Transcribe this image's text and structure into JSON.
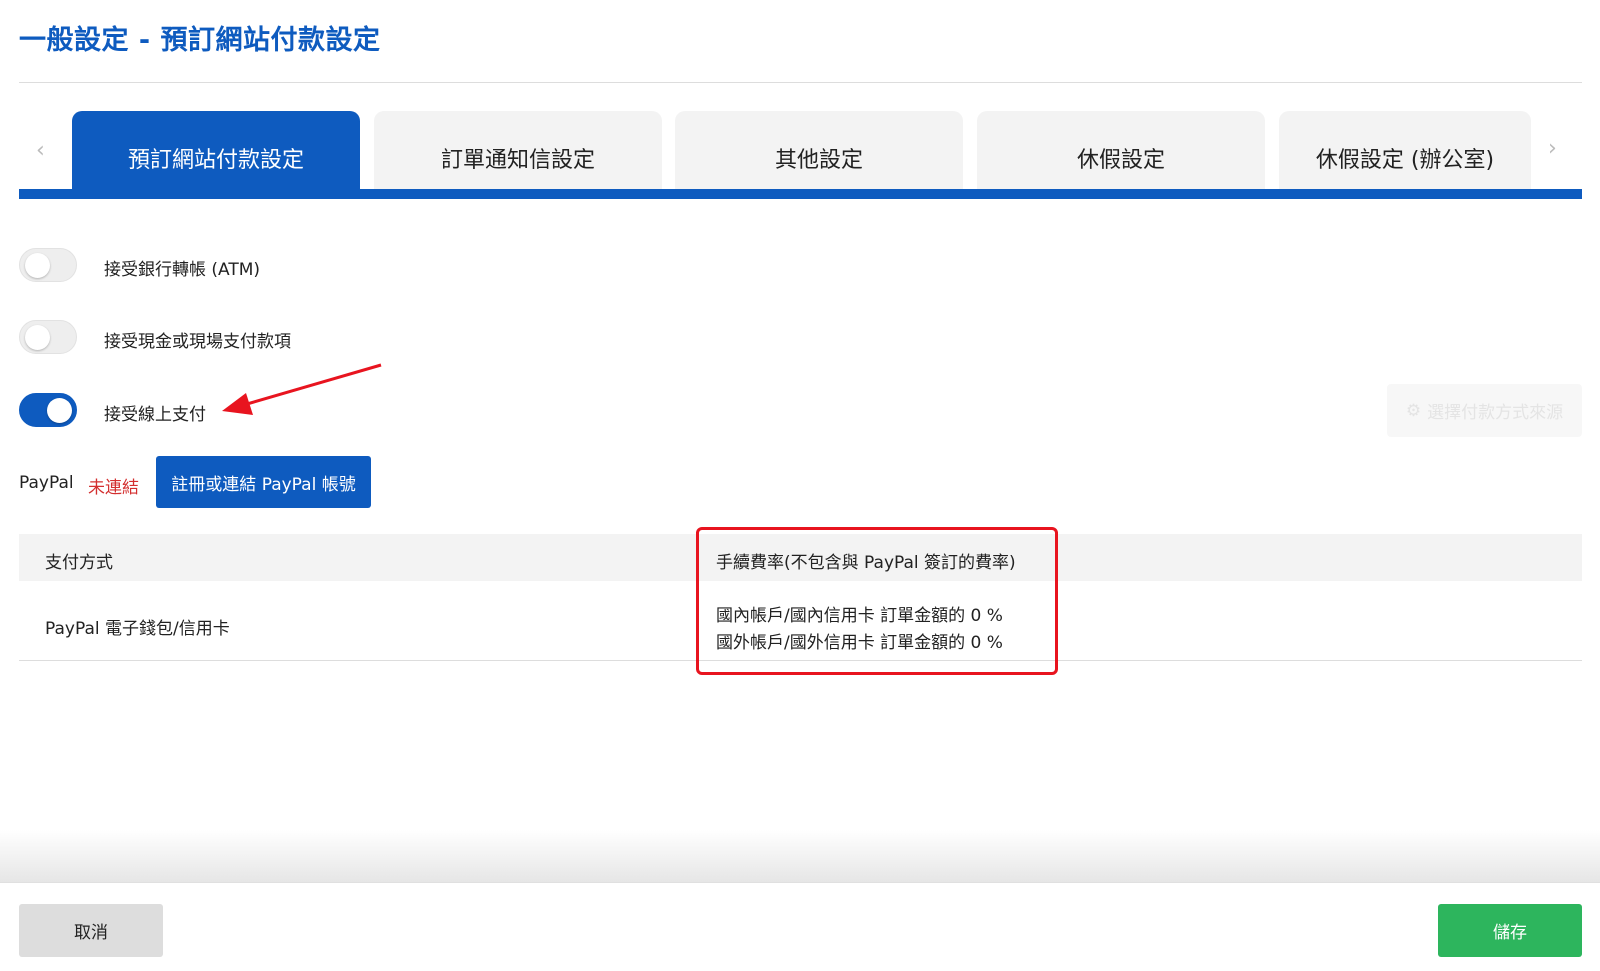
{
  "header": {
    "title": "一般設定 - 預訂網站付款設定"
  },
  "tabs": [
    {
      "label": "預訂網站付款設定",
      "active": true
    },
    {
      "label": "訂單通知信設定",
      "active": false
    },
    {
      "label": "其他設定",
      "active": false
    },
    {
      "label": "休假設定",
      "active": false
    },
    {
      "label": "休假設定 (辦公室)",
      "active": false
    }
  ],
  "tab_nav": {
    "prev_icon": "chevron-left-icon",
    "next_icon": "chevron-right-icon"
  },
  "toggles": [
    {
      "label": "接受銀行轉帳 (ATM)",
      "on": false
    },
    {
      "label": "接受現金或現場支付款項",
      "on": false
    },
    {
      "label": "接受線上支付",
      "on": true
    }
  ],
  "source_button": {
    "label": "選擇付款方式來源",
    "icon": "gear-icon"
  },
  "paypal": {
    "label": "PayPal",
    "status": "未連結",
    "status_color": "#d32f2f",
    "connect_button": "註冊或連結 PayPal 帳號"
  },
  "table": {
    "headers": [
      "支付方式",
      "手續費率(不包含與 PayPal 簽訂的費率)"
    ],
    "rows": [
      {
        "method": "PayPal 電子錢包/信用卡",
        "fees": [
          "國內帳戶/國內信用卡 訂單金額的 0 %",
          "國外帳戶/國外信用卡 訂單金額的 0 %"
        ]
      }
    ]
  },
  "footer": {
    "cancel_label": "取消",
    "save_label": "儲存"
  },
  "colors": {
    "primary": "#0e5bbf",
    "success": "#2db55d",
    "annotation": "#e8141f"
  }
}
